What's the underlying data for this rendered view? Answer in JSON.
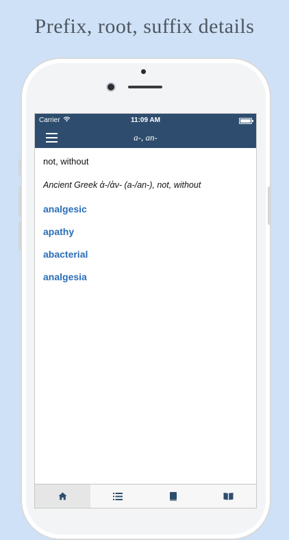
{
  "headline": "Prefix, root, suffix details",
  "status_bar": {
    "carrier": "Carrier",
    "time": "11:09 AM"
  },
  "nav": {
    "title": "a-, an-"
  },
  "entry": {
    "meaning": "not, without",
    "etymology": "Ancient Greek ἀ-/ἀν- (a-/an-), not, without",
    "examples": [
      "analgesic",
      "apathy",
      "abacterial",
      "analgesia"
    ]
  },
  "tabs": [
    {
      "icon": "home-icon",
      "active": true
    },
    {
      "icon": "list-icon",
      "active": false
    },
    {
      "icon": "book-icon",
      "active": false
    },
    {
      "icon": "open-book-icon",
      "active": false
    }
  ],
  "colors": {
    "nav_bg": "#2e4d6e",
    "link": "#2a6db8",
    "background": "#cfe1f6"
  }
}
